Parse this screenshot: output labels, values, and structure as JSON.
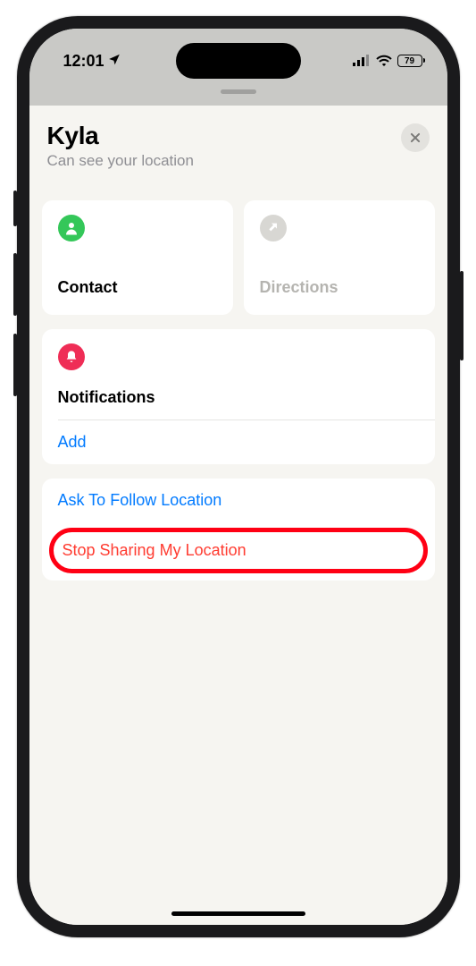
{
  "statusBar": {
    "time": "12:01",
    "battery": "79"
  },
  "header": {
    "title": "Kyla",
    "subtitle": "Can see your location"
  },
  "cards": {
    "contact": "Contact",
    "directions": "Directions"
  },
  "notifications": {
    "title": "Notifications",
    "add": "Add"
  },
  "actions": {
    "askFollow": "Ask To Follow Location",
    "stopSharing": "Stop Sharing My Location"
  }
}
